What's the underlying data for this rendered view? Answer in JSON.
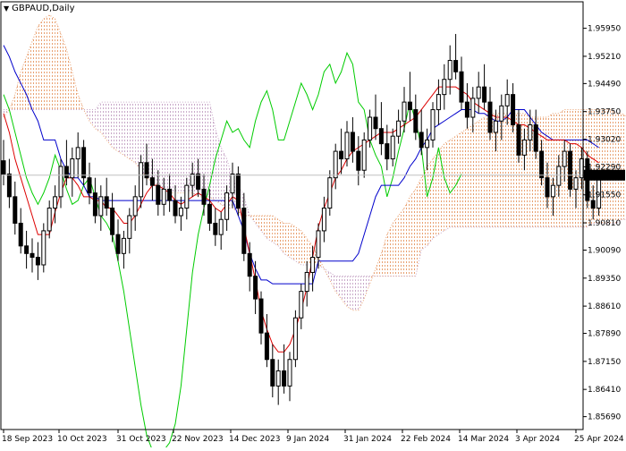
{
  "chart_data": {
    "type": "candlestick",
    "symbol_label": "GBPAUD,Daily",
    "current_price_label": "1.92070",
    "current_price": 1.9207,
    "ylim": [
      1.8535,
      1.9665
    ],
    "y_ticks": [
      "1.95950",
      "1.95210",
      "1.94490",
      "1.93750",
      "1.93020",
      "1.92290",
      "1.91550",
      "1.90810",
      "1.90090",
      "1.89350",
      "1.88610",
      "1.87890",
      "1.87150",
      "1.86410",
      "1.85690"
    ],
    "x_labels": [
      "18 Sep 2023",
      "10 Oct 2023",
      "31 Oct 2023",
      "22 Nov 2023",
      "14 Dec 2023",
      "9 Jan 2024",
      "31 Jan 2024",
      "22 Feb 2024",
      "14 Mar 2024",
      "3 Apr 2024",
      "25 Apr 2024"
    ],
    "ohlc": [
      [
        1.9245,
        1.93,
        1.918,
        1.921
      ],
      [
        1.921,
        1.925,
        1.912,
        1.915
      ],
      [
        1.915,
        1.919,
        1.905,
        1.908
      ],
      [
        1.908,
        1.912,
        1.9,
        1.902
      ],
      [
        1.902,
        1.906,
        1.896,
        1.9
      ],
      [
        1.9,
        1.904,
        1.895,
        1.899
      ],
      [
        1.899,
        1.903,
        1.893,
        1.897
      ],
      [
        1.897,
        1.908,
        1.895,
        1.906
      ],
      [
        1.906,
        1.914,
        1.904,
        1.912
      ],
      [
        1.912,
        1.918,
        1.908,
        1.915
      ],
      [
        1.915,
        1.925,
        1.912,
        1.923
      ],
      [
        1.923,
        1.93,
        1.918,
        1.92
      ],
      [
        1.92,
        1.928,
        1.915,
        1.925
      ],
      [
        1.925,
        1.932,
        1.92,
        1.928
      ],
      [
        1.928,
        1.93,
        1.918,
        1.92
      ],
      [
        1.92,
        1.924,
        1.913,
        1.916
      ],
      [
        1.916,
        1.92,
        1.908,
        1.91
      ],
      [
        1.91,
        1.918,
        1.906,
        1.915
      ],
      [
        1.915,
        1.92,
        1.91,
        1.912
      ],
      [
        1.912,
        1.916,
        1.903,
        1.905
      ],
      [
        1.905,
        1.909,
        1.898,
        1.9
      ],
      [
        1.9,
        1.906,
        1.896,
        1.904
      ],
      [
        1.904,
        1.912,
        1.9,
        1.91
      ],
      [
        1.91,
        1.918,
        1.906,
        1.915
      ],
      [
        1.915,
        1.926,
        1.912,
        1.924
      ],
      [
        1.924,
        1.929,
        1.918,
        1.92
      ],
      [
        1.92,
        1.925,
        1.914,
        1.918
      ],
      [
        1.918,
        1.922,
        1.91,
        1.913
      ],
      [
        1.913,
        1.92,
        1.91,
        1.917
      ],
      [
        1.917,
        1.921,
        1.911,
        1.914
      ],
      [
        1.914,
        1.918,
        1.908,
        1.91
      ],
      [
        1.91,
        1.915,
        1.906,
        1.912
      ],
      [
        1.912,
        1.92,
        1.909,
        1.918
      ],
      [
        1.918,
        1.924,
        1.915,
        1.921
      ],
      [
        1.921,
        1.925,
        1.915,
        1.917
      ],
      [
        1.917,
        1.921,
        1.91,
        1.913
      ],
      [
        1.913,
        1.917,
        1.906,
        1.908
      ],
      [
        1.908,
        1.912,
        1.902,
        1.905
      ],
      [
        1.905,
        1.911,
        1.901,
        1.909
      ],
      [
        1.909,
        1.918,
        1.906,
        1.916
      ],
      [
        1.916,
        1.924,
        1.912,
        1.921
      ],
      [
        1.921,
        1.923,
        1.91,
        1.912
      ],
      [
        1.912,
        1.916,
        1.898,
        1.9
      ],
      [
        1.9,
        1.903,
        1.89,
        1.894
      ],
      [
        1.894,
        1.898,
        1.884,
        1.888
      ],
      [
        1.888,
        1.89,
        1.876,
        1.879
      ],
      [
        1.879,
        1.884,
        1.87,
        1.872
      ],
      [
        1.872,
        1.876,
        1.862,
        1.865
      ],
      [
        1.865,
        1.872,
        1.86,
        1.869
      ],
      [
        1.869,
        1.876,
        1.863,
        1.865
      ],
      [
        1.865,
        1.874,
        1.861,
        1.872
      ],
      [
        1.872,
        1.885,
        1.87,
        1.883
      ],
      [
        1.883,
        1.892,
        1.88,
        1.89
      ],
      [
        1.89,
        1.898,
        1.886,
        1.895
      ],
      [
        1.895,
        1.902,
        1.89,
        1.899
      ],
      [
        1.899,
        1.908,
        1.896,
        1.906
      ],
      [
        1.906,
        1.915,
        1.903,
        1.912
      ],
      [
        1.912,
        1.922,
        1.91,
        1.92
      ],
      [
        1.92,
        1.929,
        1.917,
        1.927
      ],
      [
        1.927,
        1.933,
        1.921,
        1.925
      ],
      [
        1.925,
        1.935,
        1.923,
        1.932
      ],
      [
        1.932,
        1.936,
        1.924,
        1.927
      ],
      [
        1.927,
        1.931,
        1.918,
        1.922
      ],
      [
        1.922,
        1.932,
        1.92,
        1.93
      ],
      [
        1.93,
        1.938,
        1.928,
        1.936
      ],
      [
        1.936,
        1.942,
        1.93,
        1.933
      ],
      [
        1.933,
        1.94,
        1.926,
        1.929
      ],
      [
        1.929,
        1.934,
        1.922,
        1.925
      ],
      [
        1.925,
        1.933,
        1.923,
        1.931
      ],
      [
        1.931,
        1.938,
        1.929,
        1.935
      ],
      [
        1.935,
        1.944,
        1.932,
        1.94
      ],
      [
        1.94,
        1.948,
        1.935,
        1.938
      ],
      [
        1.938,
        1.942,
        1.93,
        1.932
      ],
      [
        1.932,
        1.938,
        1.926,
        1.928
      ],
      [
        1.928,
        1.933,
        1.922,
        1.93
      ],
      [
        1.93,
        1.94,
        1.928,
        1.938
      ],
      [
        1.938,
        1.946,
        1.934,
        1.942
      ],
      [
        1.942,
        1.95,
        1.938,
        1.946
      ],
      [
        1.946,
        1.955,
        1.942,
        1.951
      ],
      [
        1.951,
        1.958,
        1.946,
        1.948
      ],
      [
        1.948,
        1.952,
        1.938,
        1.94
      ],
      [
        1.94,
        1.945,
        1.933,
        1.936
      ],
      [
        1.936,
        1.944,
        1.932,
        1.941
      ],
      [
        1.941,
        1.948,
        1.937,
        1.944
      ],
      [
        1.944,
        1.95,
        1.938,
        1.94
      ],
      [
        1.94,
        1.944,
        1.93,
        1.932
      ],
      [
        1.932,
        1.938,
        1.927,
        1.935
      ],
      [
        1.935,
        1.942,
        1.93,
        1.939
      ],
      [
        1.939,
        1.946,
        1.934,
        1.942
      ],
      [
        1.942,
        1.945,
        1.932,
        1.934
      ],
      [
        1.934,
        1.938,
        1.924,
        1.926
      ],
      [
        1.926,
        1.933,
        1.922,
        1.93
      ],
      [
        1.93,
        1.938,
        1.927,
        1.934
      ],
      [
        1.934,
        1.938,
        1.925,
        1.927
      ],
      [
        1.927,
        1.93,
        1.918,
        1.92
      ],
      [
        1.92,
        1.924,
        1.912,
        1.915
      ],
      [
        1.915,
        1.92,
        1.91,
        1.918
      ],
      [
        1.918,
        1.926,
        1.915,
        1.923
      ],
      [
        1.923,
        1.93,
        1.919,
        1.927
      ],
      [
        1.927,
        1.929,
        1.915,
        1.917
      ],
      [
        1.917,
        1.922,
        1.912,
        1.92
      ],
      [
        1.92,
        1.928,
        1.917,
        1.925
      ],
      [
        1.925,
        1.927,
        1.912,
        1.914
      ],
      [
        1.914,
        1.918,
        1.909,
        1.912
      ],
      [
        1.912,
        1.922,
        1.91,
        1.9207
      ]
    ],
    "indicators": {
      "tenkan_sen": [
        1.937,
        1.932,
        1.925,
        1.92,
        1.915,
        1.91,
        1.905,
        1.905,
        1.905,
        1.911,
        1.916,
        1.92,
        1.92,
        1.918,
        1.915,
        1.915,
        1.914,
        1.914,
        1.912,
        1.912,
        1.91,
        1.908,
        1.908,
        1.91,
        1.913,
        1.916,
        1.918,
        1.918,
        1.917,
        1.916,
        1.914,
        1.913,
        1.914,
        1.915,
        1.916,
        1.915,
        1.914,
        1.912,
        1.911,
        1.913,
        1.915,
        1.914,
        1.907,
        1.9,
        1.893,
        1.885,
        1.88,
        1.876,
        1.874,
        1.874,
        1.876,
        1.88,
        1.885,
        1.891,
        1.899,
        1.907,
        1.912,
        1.916,
        1.92,
        1.922,
        1.925,
        1.927,
        1.928,
        1.929,
        1.93,
        1.931,
        1.932,
        1.932,
        1.932,
        1.933,
        1.934,
        1.935,
        1.936,
        1.938,
        1.94,
        1.942,
        1.944,
        1.944,
        1.944,
        1.944,
        1.943,
        1.942,
        1.94,
        1.939,
        1.938,
        1.937,
        1.936,
        1.936,
        1.936,
        1.935,
        1.934,
        1.934,
        1.933,
        1.932,
        1.931,
        1.93,
        1.93,
        1.93,
        1.93,
        1.929,
        1.929,
        1.928,
        1.926,
        1.925,
        1.924
      ],
      "kijun_sen": [
        1.955,
        1.952,
        1.948,
        1.945,
        1.942,
        1.938,
        1.935,
        1.93,
        1.93,
        1.93,
        1.925,
        1.922,
        1.92,
        1.92,
        1.918,
        1.915,
        1.915,
        1.914,
        1.914,
        1.914,
        1.914,
        1.914,
        1.914,
        1.914,
        1.914,
        1.914,
        1.914,
        1.914,
        1.914,
        1.914,
        1.914,
        1.914,
        1.914,
        1.914,
        1.914,
        1.914,
        1.914,
        1.914,
        1.914,
        1.914,
        1.914,
        1.91,
        1.906,
        1.9,
        1.896,
        1.893,
        1.893,
        1.892,
        1.892,
        1.892,
        1.892,
        1.892,
        1.892,
        1.892,
        1.892,
        1.898,
        1.898,
        1.898,
        1.898,
        1.898,
        1.898,
        1.898,
        1.9,
        1.905,
        1.91,
        1.915,
        1.918,
        1.918,
        1.918,
        1.918,
        1.92,
        1.923,
        1.925,
        1.928,
        1.93,
        1.933,
        1.934,
        1.935,
        1.936,
        1.937,
        1.938,
        1.938,
        1.938,
        1.937,
        1.937,
        1.936,
        1.935,
        1.935,
        1.936,
        1.938,
        1.938,
        1.938,
        1.936,
        1.934,
        1.932,
        1.931,
        1.93,
        1.93,
        1.93,
        1.93,
        1.93,
        1.93,
        1.93,
        1.929,
        1.928
      ],
      "chikou_span": [
        1.942,
        1.938,
        1.932,
        1.926,
        1.92,
        1.916,
        1.913,
        1.916,
        1.92,
        1.926,
        1.922,
        1.917,
        1.913,
        1.914,
        1.918,
        1.92,
        1.915,
        1.91,
        1.908,
        1.905,
        1.898,
        1.89,
        1.88,
        1.87,
        1.86,
        1.852,
        1.848,
        1.847,
        1.848,
        1.85,
        1.855,
        1.865,
        1.88,
        1.895,
        1.905,
        1.912,
        1.918,
        1.925,
        1.93,
        1.935,
        1.932,
        1.933,
        1.93,
        1.928,
        1.935,
        1.94,
        1.943,
        1.938,
        1.93,
        1.93,
        1.935,
        1.94,
        1.945,
        1.942,
        1.938,
        1.942,
        1.948,
        1.95,
        1.945,
        1.948,
        1.953,
        1.95,
        1.94,
        1.938,
        1.93,
        1.926,
        1.923,
        1.915,
        1.92,
        1.927,
        1.933,
        1.94,
        1.935,
        1.928,
        1.915,
        1.92,
        1.928,
        1.92,
        1.916,
        1.918,
        1.921
      ],
      "senkou_span_a": [
        1.936,
        1.938,
        1.942,
        1.948,
        1.952,
        1.956,
        1.96,
        1.962,
        1.963,
        1.962,
        1.958,
        1.954,
        1.948,
        1.942,
        1.938,
        1.935,
        1.933,
        1.932,
        1.93,
        1.928,
        1.927,
        1.926,
        1.925,
        1.924,
        1.922,
        1.92,
        1.919,
        1.918,
        1.917,
        1.916,
        1.916,
        1.916,
        1.916,
        1.916,
        1.915,
        1.915,
        1.915,
        1.914,
        1.913,
        1.912,
        1.912,
        1.911,
        1.91,
        1.91,
        1.91,
        1.91,
        1.91,
        1.91,
        1.909,
        1.908,
        1.908,
        1.907,
        1.906,
        1.904,
        1.902,
        1.899,
        1.896,
        1.893,
        1.89,
        1.888,
        1.886,
        1.885,
        1.885,
        1.888,
        1.892,
        1.896,
        1.9,
        1.905,
        1.908,
        1.91,
        1.912,
        1.915,
        1.917,
        1.92,
        1.923,
        1.925,
        1.927,
        1.929,
        1.93,
        1.931,
        1.932,
        1.933,
        1.934,
        1.935,
        1.936,
        1.937,
        1.937,
        1.937,
        1.937,
        1.937,
        1.937,
        1.937,
        1.936,
        1.936,
        1.936,
        1.936,
        1.937,
        1.937,
        1.938,
        1.938,
        1.938,
        1.938,
        1.938,
        1.938,
        1.938,
        1.938,
        1.938,
        1.937,
        1.937,
        1.936,
        1.936,
        1.936,
        1.936,
        1.936,
        1.936,
        1.936,
        1.936,
        1.936,
        1.936,
        1.936,
        1.936,
        1.936,
        1.936,
        1.936,
        1.936,
        1.936
      ],
      "senkou_span_b": [
        1.938,
        1.938,
        1.938,
        1.938,
        1.938,
        1.938,
        1.938,
        1.938,
        1.938,
        1.938,
        1.938,
        1.938,
        1.938,
        1.938,
        1.938,
        1.938,
        1.938,
        1.94,
        1.94,
        1.94,
        1.94,
        1.94,
        1.94,
        1.94,
        1.94,
        1.94,
        1.94,
        1.94,
        1.94,
        1.94,
        1.94,
        1.94,
        1.94,
        1.94,
        1.94,
        1.94,
        1.94,
        1.933,
        1.928,
        1.925,
        1.92,
        1.918,
        1.915,
        1.91,
        1.908,
        1.906,
        1.904,
        1.903,
        1.902,
        1.9,
        1.899,
        1.898,
        1.897,
        1.897,
        1.897,
        1.897,
        1.896,
        1.895,
        1.894,
        1.894,
        1.894,
        1.894,
        1.894,
        1.894,
        1.894,
        1.894,
        1.894,
        1.894,
        1.894,
        1.894,
        1.894,
        1.894,
        1.894,
        1.901,
        1.902,
        1.904,
        1.905,
        1.906,
        1.907,
        1.907,
        1.907,
        1.907,
        1.907,
        1.907,
        1.907,
        1.907,
        1.907,
        1.907,
        1.907,
        1.907,
        1.907,
        1.907,
        1.907,
        1.907,
        1.907,
        1.907,
        1.907,
        1.907,
        1.907,
        1.907,
        1.907,
        1.907,
        1.907,
        1.908,
        1.908,
        1.908,
        1.908,
        1.908,
        1.909,
        1.909,
        1.91,
        1.91,
        1.91,
        1.91,
        1.911,
        1.912,
        1.912,
        1.912,
        1.912,
        1.912,
        1.912,
        1.912,
        1.912,
        1.912,
        1.912,
        1.912
      ]
    },
    "colors": {
      "background": "#ffffff",
      "candle": "#000000",
      "tenkan_sen": "#dd0000",
      "kijun_sen": "#0000cc",
      "chikou_span": "#00cc00",
      "cloud_bullish": "#e8a070",
      "cloud_bearish": "#c8a8c8",
      "current_price_line": "#c0c0c0",
      "price_label_bg": "#000000",
      "price_label_text": "#ffffff"
    }
  }
}
